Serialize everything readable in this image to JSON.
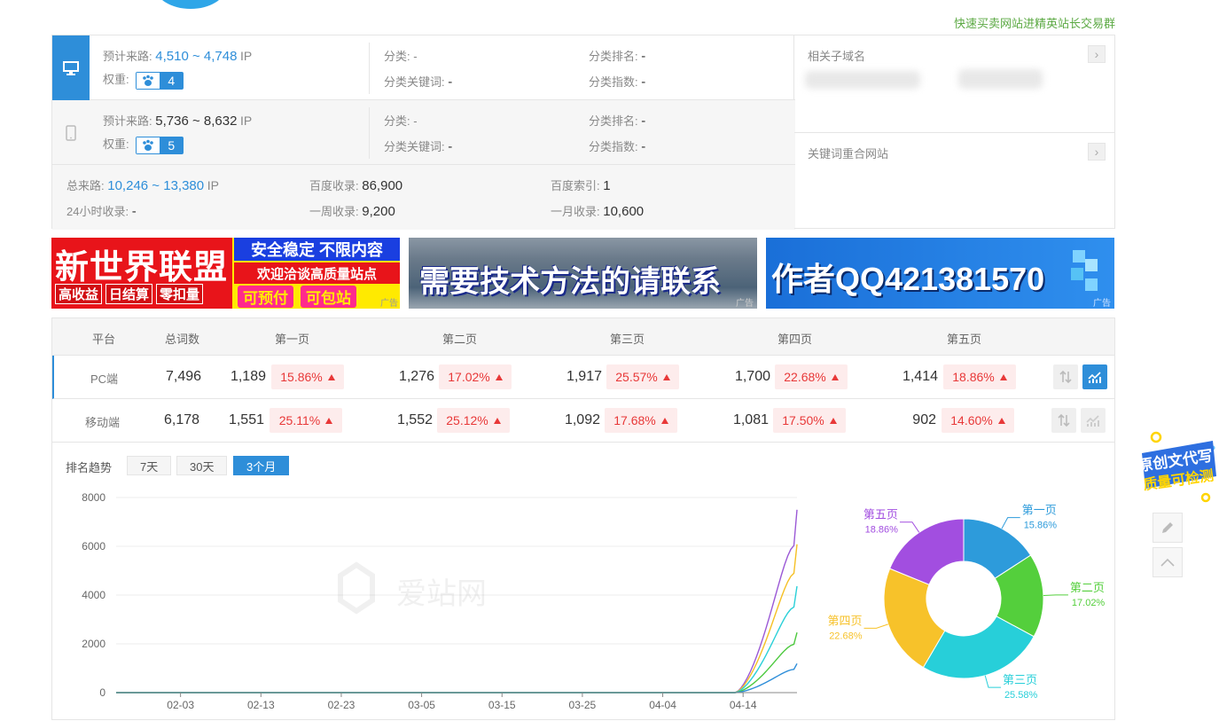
{
  "header": {
    "top_link": "快速买卖网站进精英站长交易群"
  },
  "stats": {
    "pc": {
      "label_traffic": "预计来路:",
      "traffic": "4,510 ~ 4,748",
      "ip": "IP",
      "label_weight": "权重:",
      "weight": "4",
      "label_category": "分类:",
      "category": "-",
      "label_cat_kw": "分类关键词:",
      "cat_kw": "-",
      "label_cat_rank": "分类排名:",
      "cat_rank": "-",
      "label_cat_index": "分类指数:",
      "cat_index": "-"
    },
    "mobile": {
      "label_traffic": "预计来路:",
      "traffic": "5,736 ~ 8,632",
      "ip": "IP",
      "label_weight": "权重:",
      "weight": "5",
      "label_category": "分类:",
      "category": "-",
      "label_cat_kw": "分类关键词:",
      "cat_kw": "-",
      "label_cat_rank": "分类排名:",
      "cat_rank": "-",
      "label_cat_index": "分类指数:",
      "cat_index": "-"
    },
    "total": {
      "label_total": "总来路:",
      "total": "10,246 ~ 13,380",
      "ip": "IP",
      "label_baidu_inc": "百度收录:",
      "baidu_inc": "86,900",
      "label_baidu_idx": "百度索引:",
      "baidu_idx": "1",
      "label_24h": "24小时收录:",
      "h24": "-",
      "label_week": "一周收录:",
      "week": "9,200",
      "label_month": "一月收录:",
      "month": "10,600"
    }
  },
  "side": {
    "subdomain_label": "相关子域名",
    "keyword_sites_label": "关键词重合网站"
  },
  "ads": {
    "ad1": {
      "big": "新世界联盟",
      "line1": "安全稳定 不限内容",
      "line2": "欢迎洽谈高质量站点",
      "tag1": "高收益",
      "tag2": "日结算",
      "tag3": "零扣量",
      "tag4": "可预付",
      "tag5": "可包站"
    },
    "ad2": {
      "text": "需要技术方法的请联系"
    },
    "ad3": {
      "text": "作者QQ421381570"
    },
    "ad_tag": "广告"
  },
  "rank_table": {
    "headers": [
      "平台",
      "总词数",
      "第一页",
      "第二页",
      "第三页",
      "第四页",
      "第五页"
    ],
    "rows": [
      {
        "platform": "PC端",
        "total": "7,496",
        "cells": [
          {
            "num": "1,189",
            "pct": "15.86%"
          },
          {
            "num": "1,276",
            "pct": "17.02%"
          },
          {
            "num": "1,917",
            "pct": "25.57%"
          },
          {
            "num": "1,700",
            "pct": "22.68%"
          },
          {
            "num": "1,414",
            "pct": "18.86%"
          }
        ]
      },
      {
        "platform": "移动端",
        "total": "6,178",
        "cells": [
          {
            "num": "1,551",
            "pct": "25.11%"
          },
          {
            "num": "1,552",
            "pct": "25.12%"
          },
          {
            "num": "1,092",
            "pct": "17.68%"
          },
          {
            "num": "1,081",
            "pct": "17.50%"
          },
          {
            "num": "902",
            "pct": "14.60%"
          }
        ]
      }
    ]
  },
  "trend": {
    "label": "排名趋势",
    "tabs": [
      "7天",
      "30天",
      "3个月"
    ],
    "active_tab": "3个月",
    "watermark": "爱站网"
  },
  "chart_data": [
    {
      "type": "line",
      "x": [
        "02-03",
        "02-13",
        "02-23",
        "03-05",
        "03-15",
        "03-25",
        "04-04",
        "04-14"
      ],
      "ylim": [
        0,
        8000
      ],
      "yticks": [
        0,
        2000,
        4000,
        6000,
        8000
      ],
      "series": [
        {
          "color": "#9b59d6",
          "end": 7496
        },
        {
          "color": "#f5c024",
          "end": 6082
        },
        {
          "color": "#2ad0d8",
          "end": 4365
        },
        {
          "color": "#4dc93f",
          "end": 2465
        },
        {
          "color": "#2e8ed9",
          "end": 1189
        }
      ]
    },
    {
      "type": "pie",
      "slices": [
        {
          "label": "第一页",
          "value": 15.86,
          "text": "15.86%",
          "color": "#2d9bdb"
        },
        {
          "label": "第二页",
          "value": 17.02,
          "text": "17.02%",
          "color": "#54cf3c"
        },
        {
          "label": "第三页",
          "value": 25.58,
          "text": "25.58%",
          "color": "#27cfd9"
        },
        {
          "label": "第四页",
          "value": 22.68,
          "text": "22.68%",
          "color": "#f7c22a"
        },
        {
          "label": "第五页",
          "value": 18.86,
          "text": "18.86%",
          "color": "#a24ee0"
        }
      ]
    }
  ],
  "float": {
    "line1": "原创文代写",
    "line2": "质量可检测"
  }
}
